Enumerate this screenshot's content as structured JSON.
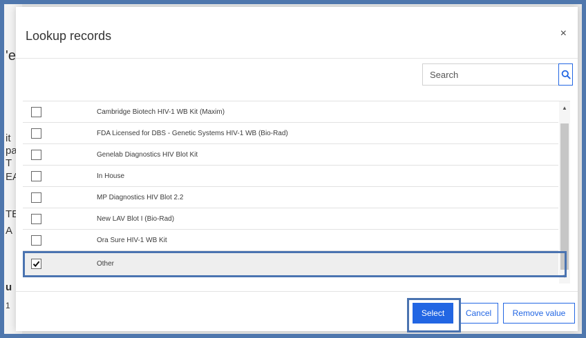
{
  "background": {
    "fragments": [
      "'e",
      "it",
      "pa",
      "T",
      "EA",
      "TE",
      "A",
      "u",
      "1"
    ]
  },
  "dialog": {
    "title": "Lookup records",
    "close_glyph": "×",
    "search": {
      "placeholder": "Search",
      "value": ""
    },
    "records": [
      {
        "label": "Cambridge Biotech HIV-1 WB Kit (Maxim)",
        "checked": false
      },
      {
        "label": "FDA Licensed for DBS - Genetic Systems HIV-1 WB (Bio-Rad)",
        "checked": false
      },
      {
        "label": "Genelab Diagnostics HIV Blot Kit",
        "checked": false
      },
      {
        "label": "In House",
        "checked": false
      },
      {
        "label": "MP Diagnostics HIV Blot 2.2",
        "checked": false
      },
      {
        "label": "New LAV Blot I (Bio-Rad)",
        "checked": false
      },
      {
        "label": "Ora Sure HIV-1 WB Kit",
        "checked": false
      },
      {
        "label": "Other",
        "checked": true
      }
    ],
    "buttons": {
      "select": "Select",
      "cancel": "Cancel",
      "remove": "Remove value"
    }
  },
  "colors": {
    "accent": "#2266e3",
    "annotation_outline": "#4a73b0",
    "selected_row": "#eeeeee"
  },
  "icons": {
    "search": "search-icon",
    "close": "close-icon",
    "check": "checkmark-icon"
  }
}
